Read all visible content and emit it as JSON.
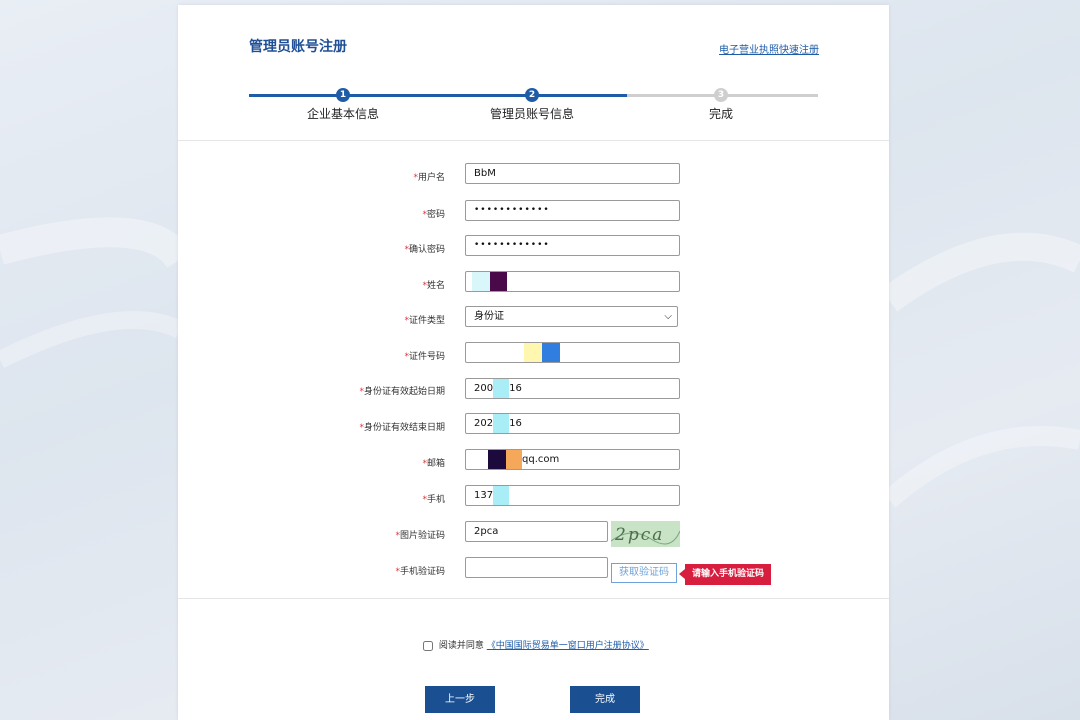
{
  "header": {
    "title": "管理员账号注册",
    "quick_register_link": "电子营业执照快速注册"
  },
  "steps": [
    {
      "number": "1",
      "label": "企业基本信息",
      "state": "done"
    },
    {
      "number": "2",
      "label": "管理员账号信息",
      "state": "current"
    },
    {
      "number": "3",
      "label": "完成",
      "state": "pending"
    }
  ],
  "form": {
    "required_mark": "*",
    "username": {
      "label": "用户名",
      "value": "BbM"
    },
    "password": {
      "label": "密码",
      "value": "••••••••••••"
    },
    "confirm_password": {
      "label": "确认密码",
      "value": "••••••••••••"
    },
    "name": {
      "label": "姓名",
      "value": ""
    },
    "id_type": {
      "label": "证件类型",
      "value": "身份证"
    },
    "id_number": {
      "label": "证件号码",
      "value": ""
    },
    "id_start_date": {
      "label": "身份证有效起始日期",
      "value_prefix": "200",
      "value_suffix": "16"
    },
    "id_end_date": {
      "label": "身份证有效结束日期",
      "value_prefix": "202",
      "value_suffix": "16"
    },
    "email": {
      "label": "邮箱",
      "value_suffix": "qq.com"
    },
    "phone": {
      "label": "手机",
      "value_prefix": "137"
    },
    "image_captcha": {
      "label": "图片验证码",
      "value": "2pca",
      "image_text": "2pca"
    },
    "sms_code": {
      "label": "手机验证码",
      "value": "",
      "button": "获取验证码",
      "error_tip": "请输入手机验证码"
    }
  },
  "agreement": {
    "prefix": "阅读并同意",
    "link": "《中国国际贸易单一窗口用户注册协议》",
    "checked": false
  },
  "buttons": {
    "prev": "上一步",
    "finish": "完成"
  },
  "colors": {
    "primary": "#1a4f92",
    "step_active": "#1f5ca8",
    "step_inactive": "#cfcfcf",
    "error": "#d81e3f",
    "required": "#e0323a"
  }
}
